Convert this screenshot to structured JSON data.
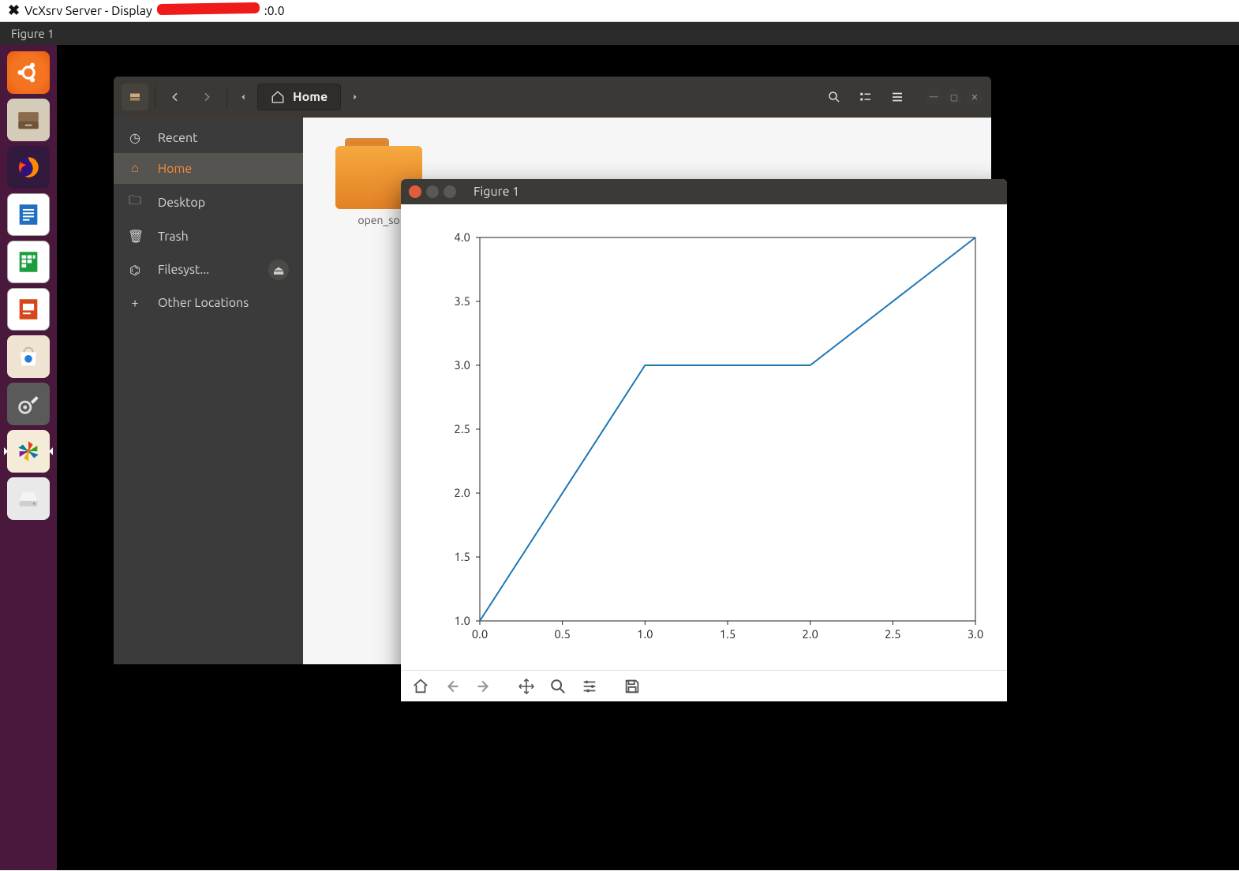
{
  "host": {
    "title_prefix": "VcXsrv Server - Display ",
    "title_redacted": true,
    "title_suffix": ":0.0"
  },
  "xserver": {
    "window_title": "Figure 1"
  },
  "launcher": {
    "items": [
      {
        "name": "ubuntu-dash",
        "icon": "ubuntu"
      },
      {
        "name": "files",
        "icon": "files"
      },
      {
        "name": "firefox",
        "icon": "firefox"
      },
      {
        "name": "writer",
        "icon": "writer"
      },
      {
        "name": "calc",
        "icon": "calc"
      },
      {
        "name": "impress",
        "icon": "impress"
      },
      {
        "name": "software",
        "icon": "software"
      },
      {
        "name": "settings",
        "icon": "settings"
      },
      {
        "name": "orange-app",
        "icon": "orange"
      },
      {
        "name": "external-drive",
        "icon": "drive"
      }
    ]
  },
  "nautilus": {
    "path_label": "Home",
    "places": {
      "recent": {
        "label": "Recent"
      },
      "home": {
        "label": "Home"
      },
      "desktop": {
        "label": "Desktop"
      },
      "trash": {
        "label": "Trash"
      },
      "filesystem": {
        "label": "Filesyst..."
      },
      "other": {
        "label": "Other Locations"
      }
    },
    "file0_label": "open_so"
  },
  "figure": {
    "title": "Figure 1",
    "toolbar": [
      "home",
      "back",
      "forward",
      "pan",
      "zoom",
      "configure",
      "save"
    ]
  },
  "chart_data": {
    "type": "line",
    "x": [
      0.0,
      1.0,
      2.0,
      3.0
    ],
    "y": [
      1.0,
      3.0,
      3.0,
      4.0
    ],
    "xlabel": "",
    "ylabel": "",
    "xlim": [
      0.0,
      3.0
    ],
    "ylim": [
      1.0,
      4.0
    ],
    "xticks": [
      0.0,
      0.5,
      1.0,
      1.5,
      2.0,
      2.5,
      3.0
    ],
    "yticks": [
      1.0,
      1.5,
      2.0,
      2.5,
      3.0,
      3.5,
      4.0
    ],
    "title": ""
  }
}
